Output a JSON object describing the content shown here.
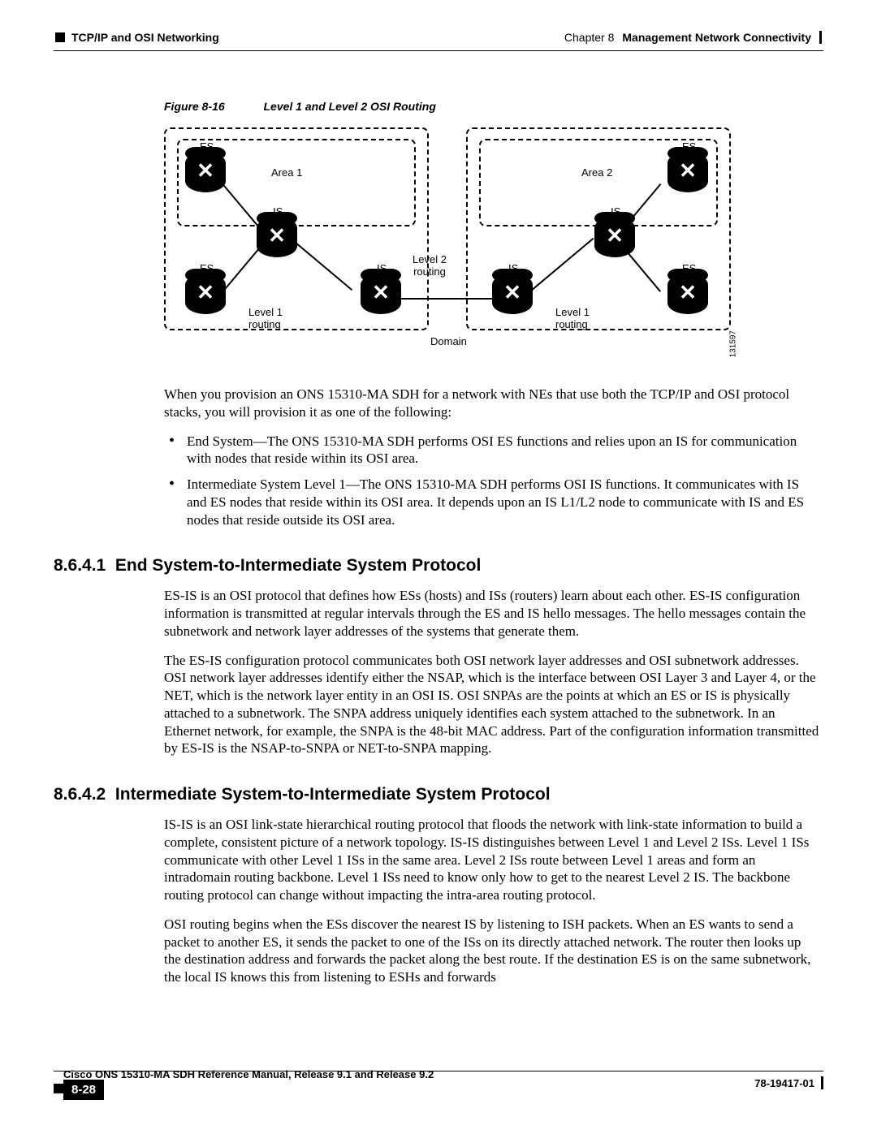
{
  "header": {
    "section": "TCP/IP and OSI Networking",
    "chapter_label": "Chapter 8",
    "chapter_title": "Management Network Connectivity"
  },
  "figure": {
    "label": "Figure 8-16",
    "title": "Level 1 and Level 2 OSI Routing",
    "area1": "Area 1",
    "area2": "Area 2",
    "es": "ES",
    "is": "IS",
    "level2": "Level 2\nrouting",
    "level1": "Level 1\nrouting",
    "domain": "Domain",
    "id": "131597"
  },
  "body": {
    "p1": "When you provision an ONS 15310-MA SDH for a network with NEs that use both the TCP/IP and OSI protocol stacks, you will provision it as one of the following:",
    "li1": "End System—The ONS 15310-MA SDH performs OSI ES functions and relies upon an IS for communication with nodes that reside within its OSI area.",
    "li2": "Intermediate System Level 1—The ONS 15310-MA SDH performs OSI IS functions. It communicates with IS and ES nodes that reside within its OSI area. It depends upon an IS L1/L2 node to communicate with IS and ES nodes that reside outside its OSI area."
  },
  "sections": {
    "h1_num": "8.6.4.1",
    "h1_title": "End System-to-Intermediate System Protocol",
    "s1_p1": "ES-IS is an OSI protocol that defines how ESs (hosts) and ISs (routers) learn about each other. ES-IS configuration information is transmitted at regular intervals through the ES and IS hello messages. The hello messages contain the subnetwork and network layer addresses of the systems that generate them.",
    "s1_p2": "The ES-IS configuration protocol communicates both OSI network layer addresses and OSI subnetwork addresses. OSI network layer addresses identify either the NSAP, which is the interface between OSI Layer 3 and Layer 4, or the NET, which is the network layer entity in an OSI IS. OSI SNPAs are the points at which an ES or IS is physically attached to a subnetwork. The SNPA address uniquely identifies each system attached to the subnetwork. In an Ethernet network, for example, the SNPA is the 48-bit MAC address. Part of the configuration information transmitted by ES-IS is the NSAP-to-SNPA or NET-to-SNPA mapping.",
    "h2_num": "8.6.4.2",
    "h2_title": "Intermediate System-to-Intermediate System Protocol",
    "s2_p1": "IS-IS is an OSI link-state hierarchical routing protocol that floods the network with link-state information to build a complete, consistent picture of a network topology. IS-IS distinguishes between Level 1 and Level 2 ISs. Level 1 ISs communicate with other Level 1 ISs in the same area. Level 2 ISs route between Level 1 areas and form an intradomain routing backbone. Level 1 ISs need to know only how to get to the nearest Level 2 IS. The backbone routing protocol can change without impacting the intra-area routing protocol.",
    "s2_p2": "OSI routing begins when the ESs discover the nearest IS by listening to ISH packets. When an ES wants to send a packet to another ES, it sends the packet to one of the ISs on its directly attached network. The router then looks up the destination address and forwards the packet along the best route. If the destination ES is on the same subnetwork, the local IS knows this from listening to ESHs and forwards"
  },
  "footer": {
    "doc": "Cisco ONS 15310-MA SDH Reference Manual, Release 9.1 and Release 9.2",
    "page": "8-28",
    "docnum": "78-19417-01"
  }
}
